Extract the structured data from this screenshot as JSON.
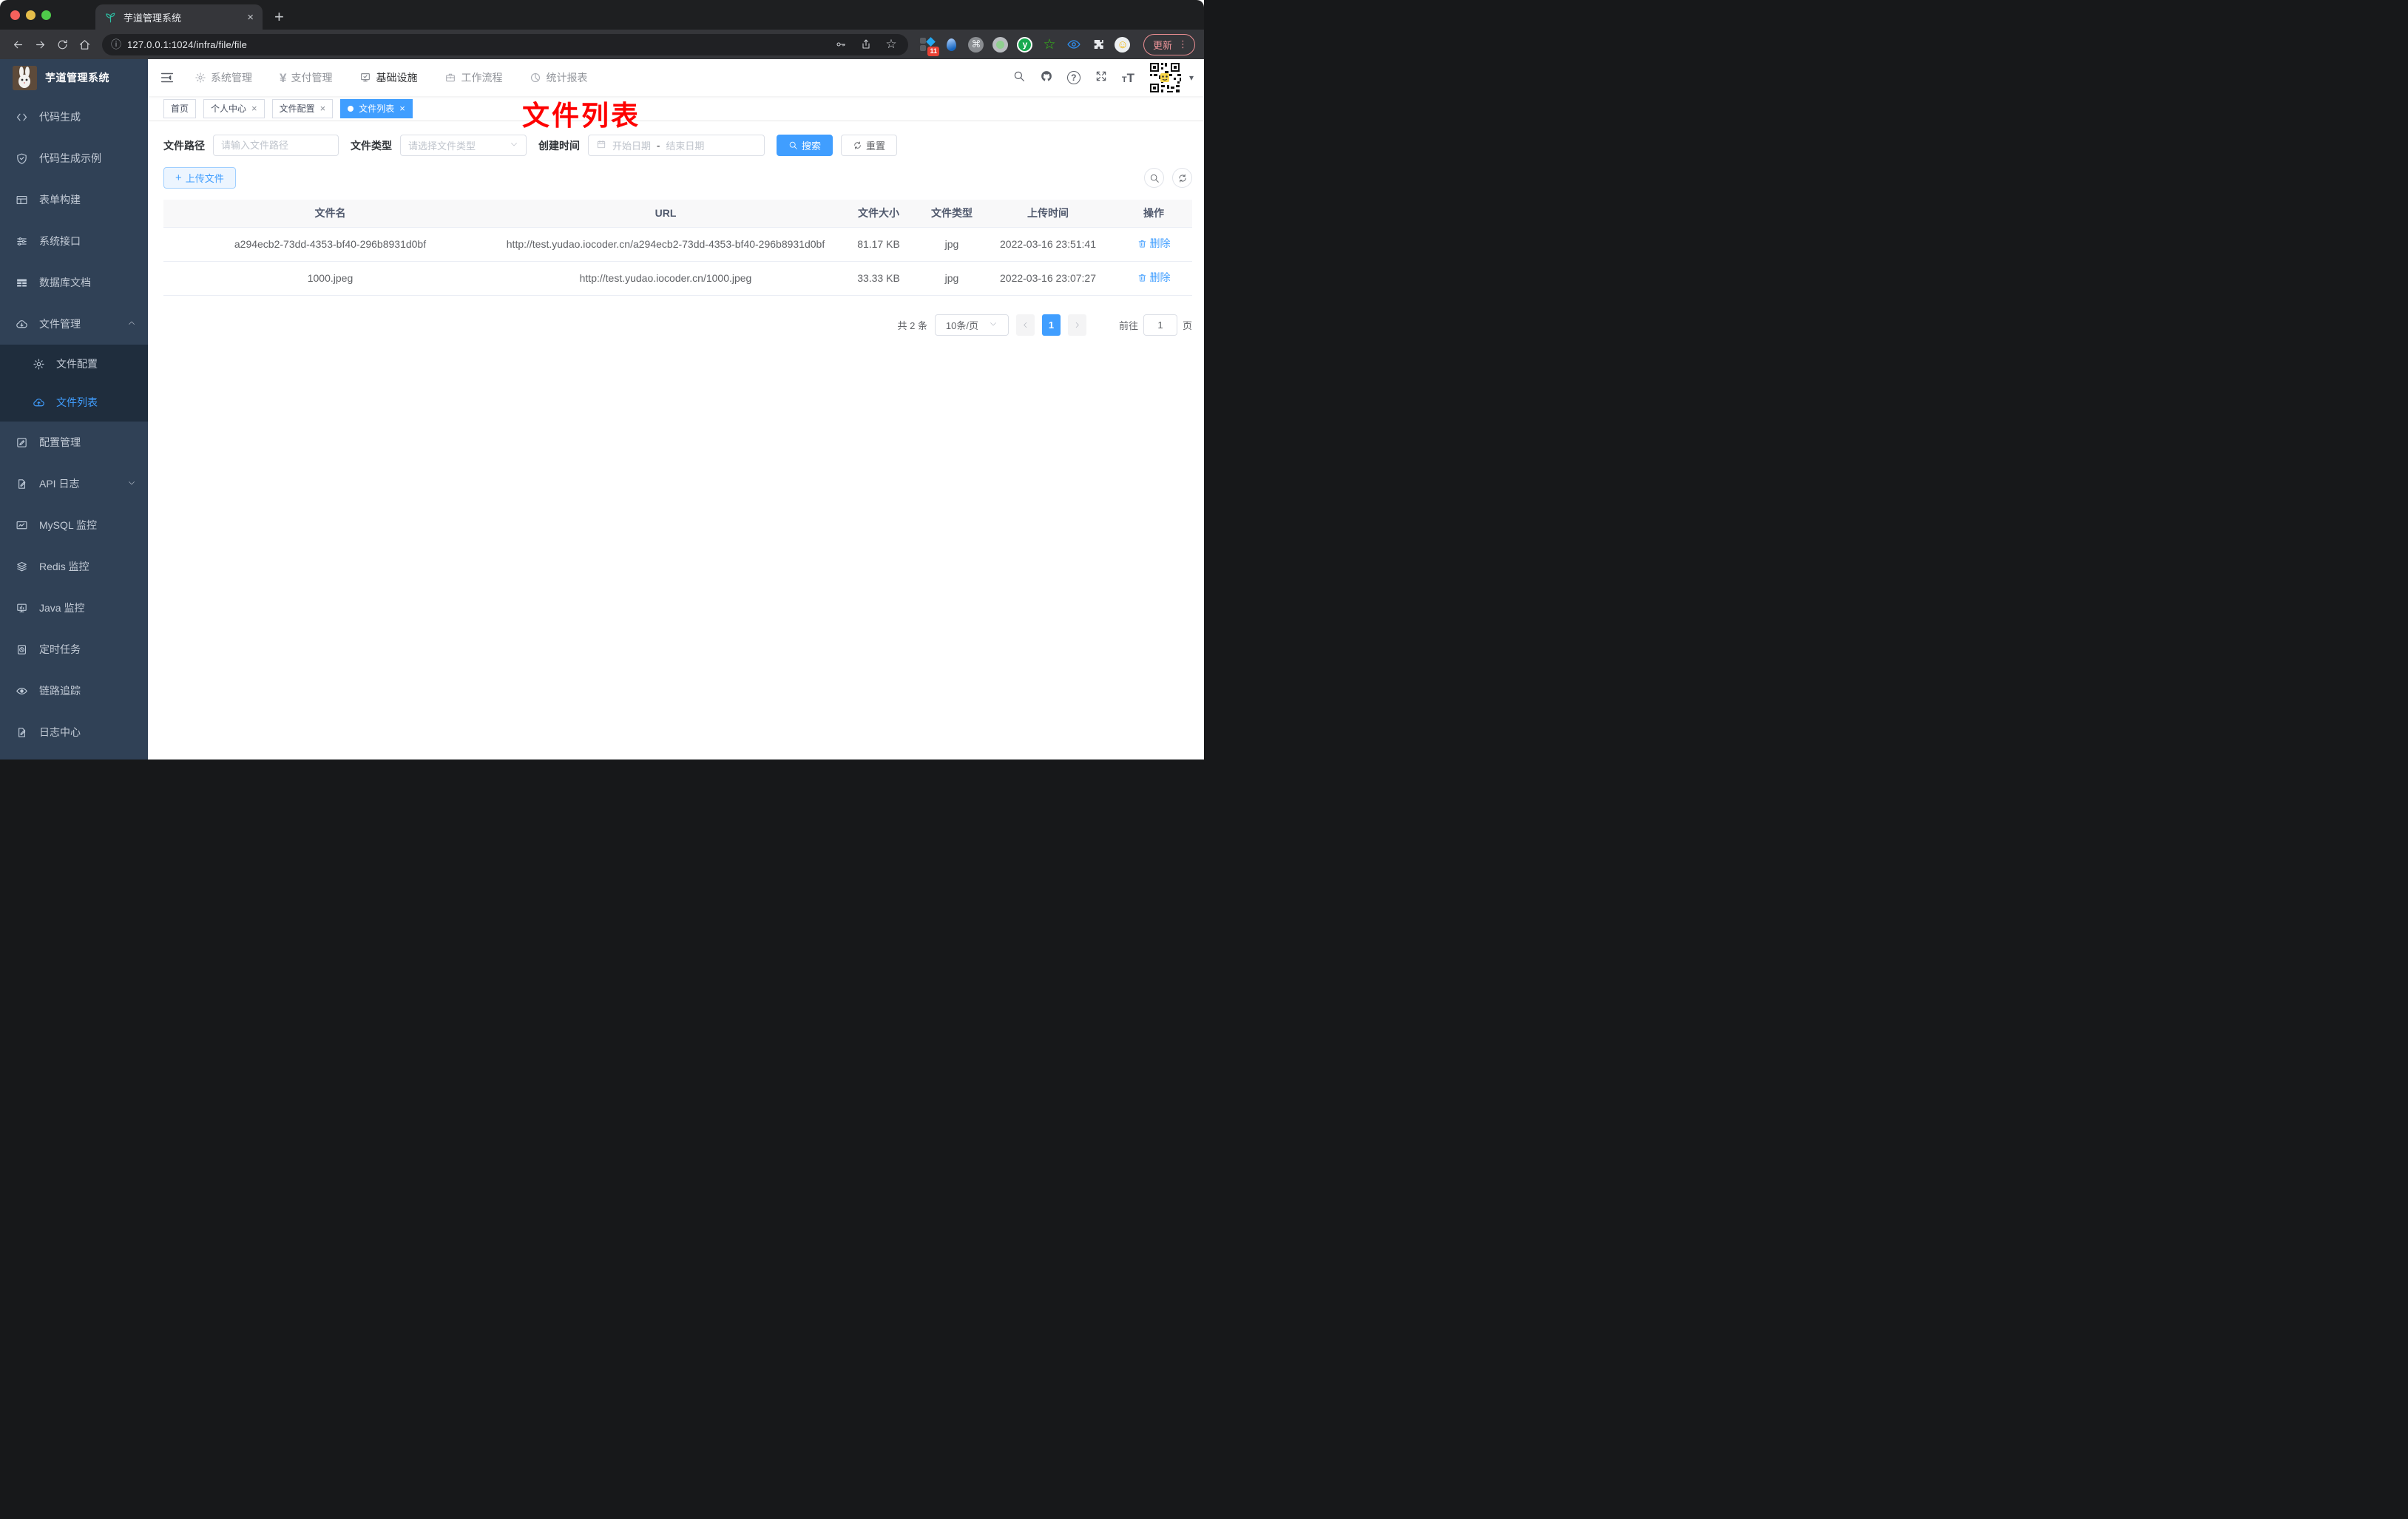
{
  "glyphs": {
    "close": "×",
    "new_tab": "+",
    "plus": "+",
    "kebab": "⋮",
    "command": "⌘",
    "star_outline": "☆",
    "smiley": "☺",
    "info": "ⓘ",
    "question": "?",
    "caret_down": "▾",
    "yen": "¥",
    "font_large": "T",
    "font_small": "T"
  },
  "browser": {
    "tab_title": "芋道管理系统",
    "url": "127.0.0.1:1024/infra/file/file",
    "update_label": "更新",
    "extension_badge": "11",
    "ext_y_label": "y"
  },
  "app": {
    "logo_title": "芋道管理系统",
    "annotation": "文件列表"
  },
  "topnav": {
    "items": [
      {
        "label": "系统管理",
        "icon": "gear-icon"
      },
      {
        "label": "支付管理",
        "icon": "yen-icon"
      },
      {
        "label": "基础设施",
        "icon": "monitor-check-icon",
        "active": true
      },
      {
        "label": "工作流程",
        "icon": "briefcase-icon"
      },
      {
        "label": "统计报表",
        "icon": "dashboard-icon"
      }
    ]
  },
  "sidebar": {
    "items": [
      {
        "label": "代码生成",
        "icon": "code-icon"
      },
      {
        "label": "代码生成示例",
        "icon": "shield-check-icon"
      },
      {
        "label": "表单构建",
        "icon": "form-grid-icon"
      },
      {
        "label": "系统接口",
        "icon": "sliders-icon"
      },
      {
        "label": "数据库文档",
        "icon": "database-table-icon"
      },
      {
        "label": "文件管理",
        "icon": "cloud-download-icon",
        "expanded": true,
        "children": [
          {
            "label": "文件配置",
            "icon": "gear-icon"
          },
          {
            "label": "文件列表",
            "icon": "cloud-upload-icon",
            "active": true
          }
        ]
      },
      {
        "label": "配置管理",
        "icon": "edit-square-icon"
      },
      {
        "label": "API 日志",
        "icon": "doc-edit-icon",
        "collapsed": true
      },
      {
        "label": "MySQL 监控",
        "icon": "chart-box-icon"
      },
      {
        "label": "Redis 监控",
        "icon": "layers-icon"
      },
      {
        "label": "Java 监控",
        "icon": "monitor-stats-icon"
      },
      {
        "label": "定时任务",
        "icon": "timer-doc-icon"
      },
      {
        "label": "链路追踪",
        "icon": "eye-icon"
      },
      {
        "label": "日志中心",
        "icon": "doc-edit-icon"
      }
    ]
  },
  "tags": {
    "items": [
      {
        "label": "首页",
        "closable": false
      },
      {
        "label": "个人中心",
        "closable": true
      },
      {
        "label": "文件配置",
        "closable": true
      },
      {
        "label": "文件列表",
        "closable": true,
        "active": true
      }
    ]
  },
  "filters": {
    "path_label": "文件路径",
    "path_placeholder": "请输入文件路径",
    "type_label": "文件类型",
    "type_placeholder": "请选择文件类型",
    "date_label": "创建时间",
    "date_start": "开始日期",
    "date_separator": "-",
    "date_end": "结束日期",
    "search_label": "搜索",
    "reset_label": "重置",
    "upload_label": "上传文件"
  },
  "table": {
    "headers": [
      "文件名",
      "URL",
      "文件大小",
      "文件类型",
      "上传时间",
      "操作"
    ],
    "rows": [
      {
        "name": "a294ecb2-73dd-4353-bf40-296b8931d0bf",
        "url": "http://test.yudao.iocoder.cn/a294ecb2-73dd-4353-bf40-296b8931d0bf",
        "size": "81.17 KB",
        "type": "jpg",
        "time": "2022-03-16 23:51:41",
        "action": "删除"
      },
      {
        "name": "1000.jpeg",
        "url": "http://test.yudao.iocoder.cn/1000.jpeg",
        "size": "33.33 KB",
        "type": "jpg",
        "time": "2022-03-16 23:07:27",
        "action": "删除"
      }
    ]
  },
  "pagination": {
    "total": "共 2 条",
    "page_size": "10条/页",
    "page": "1",
    "goto_label": "前往",
    "goto_value": "1",
    "page_unit": "页"
  },
  "colors": {
    "accent": "#409eff",
    "sidebar_bg": "#304156",
    "submenu_bg": "#1f2d3d",
    "annotation": "#fe0000"
  }
}
